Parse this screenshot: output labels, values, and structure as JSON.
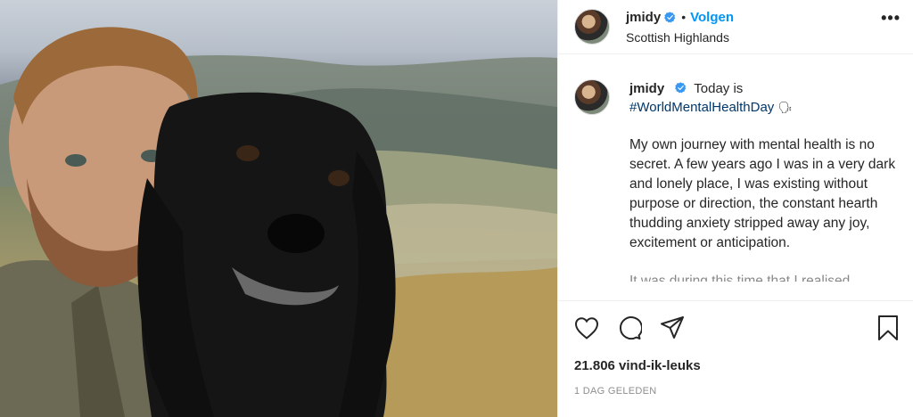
{
  "post": {
    "photo_alt": "",
    "header": {
      "username": "jmidy",
      "verified": true,
      "dot": "•",
      "follow_label": "Volgen",
      "location": "Scottish Highlands",
      "more_label": "•••"
    },
    "caption": {
      "username": "jmidy",
      "intro": "Today is",
      "hashtag": "#WorldMentalHealthDay",
      "emoji": "🗣",
      "paragraph": "My own journey with mental health is no secret. A few years ago I was in a very dark and lonely place, I was existing without purpose or direction, the constant hearth thudding anxiety stripped away any joy, excitement or anticipation.",
      "cut_line": "It was during this time that I realised"
    },
    "actions": {
      "like_icon": "heart-icon",
      "comment_icon": "comment-icon",
      "share_icon": "share-icon",
      "save_icon": "bookmark-icon"
    },
    "likes": "21.806 vind-ik-leuks",
    "timestamp": "1 dag geleden",
    "colors": {
      "accent": "#0095f6",
      "hashtag": "#00376b",
      "verified": "#3897f0",
      "text": "#262626",
      "muted": "#8e8e8e"
    }
  }
}
